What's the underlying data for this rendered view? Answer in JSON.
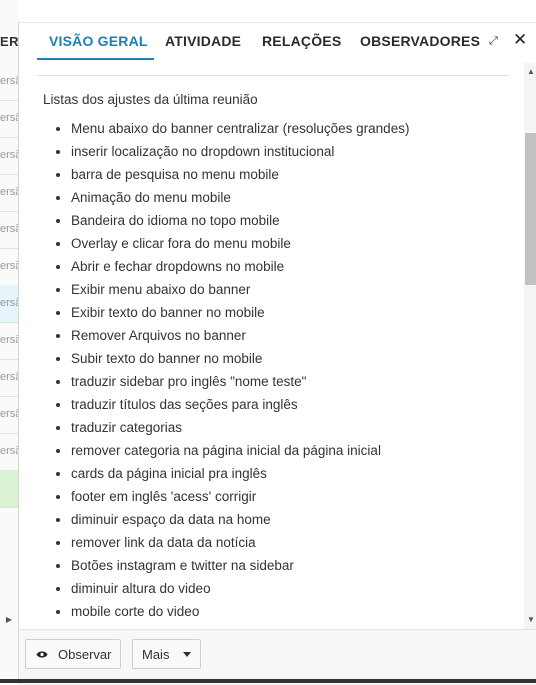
{
  "background": {
    "column_header": "ERS",
    "rows": [
      "ersã",
      "ersã",
      "ersã",
      "ersã",
      "ersã",
      "ersã",
      "ersã",
      "ersã",
      "ersã",
      "ersã",
      "ersã",
      ""
    ]
  },
  "tabs": [
    {
      "label": "VISÃO GERAL",
      "active": true
    },
    {
      "label": "ATIVIDADE"
    },
    {
      "label": "RELAÇÕES"
    },
    {
      "label": "OBSERVADORES"
    }
  ],
  "content": {
    "intro": "Listas dos ajustes da última reunião",
    "items": [
      "Menu abaixo do banner centralizar (resoluções grandes)",
      "inserir localização no dropdown institucional",
      "barra de pesquisa no menu mobile",
      "Animação do menu mobile",
      "Bandeira do idioma no topo mobile",
      "Overlay e clicar fora do menu mobile",
      "Abrir e fechar dropdowns no mobile",
      "Exibir menu abaixo do banner",
      "Exibir texto do banner no mobile",
      "Remover Arquivos no banner",
      "Subir texto do banner no mobile",
      "traduzir sidebar pro inglês \"nome teste\"",
      "traduzir títulos das seções para inglês",
      "traduzir categorias",
      "remover categoria na página inicial da página inicial",
      "cards da página inicial pra inglês",
      "footer em inglês 'acess' corrigir",
      "diminuir espaço da data na home",
      "remover link da data da notícia",
      "Botões instagram e twitter na sidebar",
      "diminuir altura do video",
      "mobile corte do video"
    ]
  },
  "footer": {
    "observe_label": "Observar",
    "more_label": "Mais"
  },
  "icons": {
    "expand": "expand-icon",
    "close": "close-icon",
    "eye": "eye-icon",
    "caret": "caret-down-icon"
  },
  "colors": {
    "accent": "#1e7fb5",
    "selected_row": "#e6f4fb",
    "highlight_row": "#d9f3d4"
  }
}
